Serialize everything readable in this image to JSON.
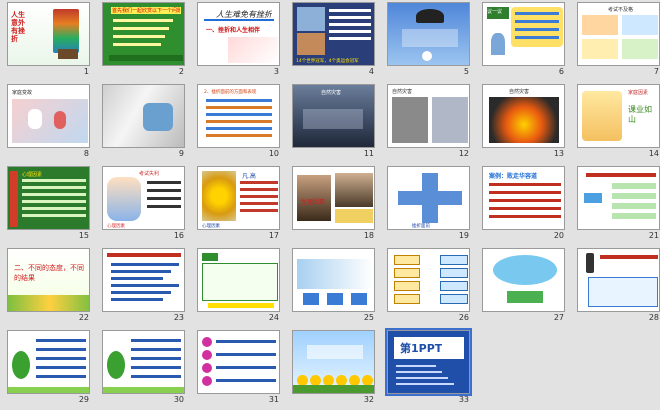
{
  "slides": [
    {
      "num": "1",
      "title": "人生意外有挫折",
      "theme": "cover-books"
    },
    {
      "num": "2",
      "title": "首先我们一起欣赏以下一个问题",
      "theme": "green-question"
    },
    {
      "num": "3",
      "title": "人生难免有挫折",
      "subtitle": "一、挫折和人生相伴",
      "theme": "white-title"
    },
    {
      "num": "4",
      "title": "体育比赛",
      "caption": "14个世界冠军，4个奥运会冠军",
      "theme": "sports"
    },
    {
      "num": "5",
      "title": "",
      "theme": "blue-eagle"
    },
    {
      "num": "6",
      "title": "议一议",
      "theme": "yellow-discuss"
    },
    {
      "num": "7",
      "title": "考试不及格",
      "theme": "cartoon-exam"
    },
    {
      "num": "8",
      "title": "家庭变故",
      "theme": "family-photo"
    },
    {
      "num": "9",
      "title": "",
      "theme": "hospital"
    },
    {
      "num": "10",
      "title": "2、挫折面前的方面和表现",
      "theme": "orange-list"
    },
    {
      "num": "11",
      "title": "自然灾害",
      "theme": "disaster"
    },
    {
      "num": "12",
      "title": "自然灾害",
      "theme": "road-crack"
    },
    {
      "num": "13",
      "title": "自然灾害",
      "theme": "explosion"
    },
    {
      "num": "14",
      "title": "家庭因素",
      "caption": "课业如山",
      "theme": "study"
    },
    {
      "num": "15",
      "title": "心理因素",
      "theme": "green-text"
    },
    {
      "num": "16",
      "title": "考试失利",
      "caption": "心理因素",
      "theme": "cartoon-boy"
    },
    {
      "num": "17",
      "title": "凡.高",
      "caption": "心理因素",
      "theme": "vangogh"
    },
    {
      "num": "18",
      "title": "生理因素",
      "theme": "model"
    },
    {
      "num": "19",
      "title": "挫折面前",
      "theme": "arrows"
    },
    {
      "num": "20",
      "title": "案例：败走华容道",
      "theme": "case"
    },
    {
      "num": "21",
      "title": "",
      "theme": "mindmap"
    },
    {
      "num": "22",
      "title": "二、不同的态度，不同的结果",
      "theme": "leaf-title"
    },
    {
      "num": "23",
      "title": "",
      "theme": "text-list"
    },
    {
      "num": "24",
      "title": "",
      "theme": "green-box"
    },
    {
      "num": "25",
      "title": "",
      "theme": "blue-diagram"
    },
    {
      "num": "26",
      "title": "",
      "theme": "flow"
    },
    {
      "num": "27",
      "title": "",
      "theme": "cloud-diagram"
    },
    {
      "num": "28",
      "title": "",
      "theme": "traffic"
    },
    {
      "num": "29",
      "title": "",
      "theme": "frog-list"
    },
    {
      "num": "30",
      "title": "",
      "theme": "frog-list2"
    },
    {
      "num": "31",
      "title": "",
      "theme": "pink-list"
    },
    {
      "num": "32",
      "title": "",
      "theme": "sunflower"
    },
    {
      "num": "33",
      "title": "第1PPT",
      "theme": "ppt-logo"
    }
  ],
  "selected_slide": "33"
}
